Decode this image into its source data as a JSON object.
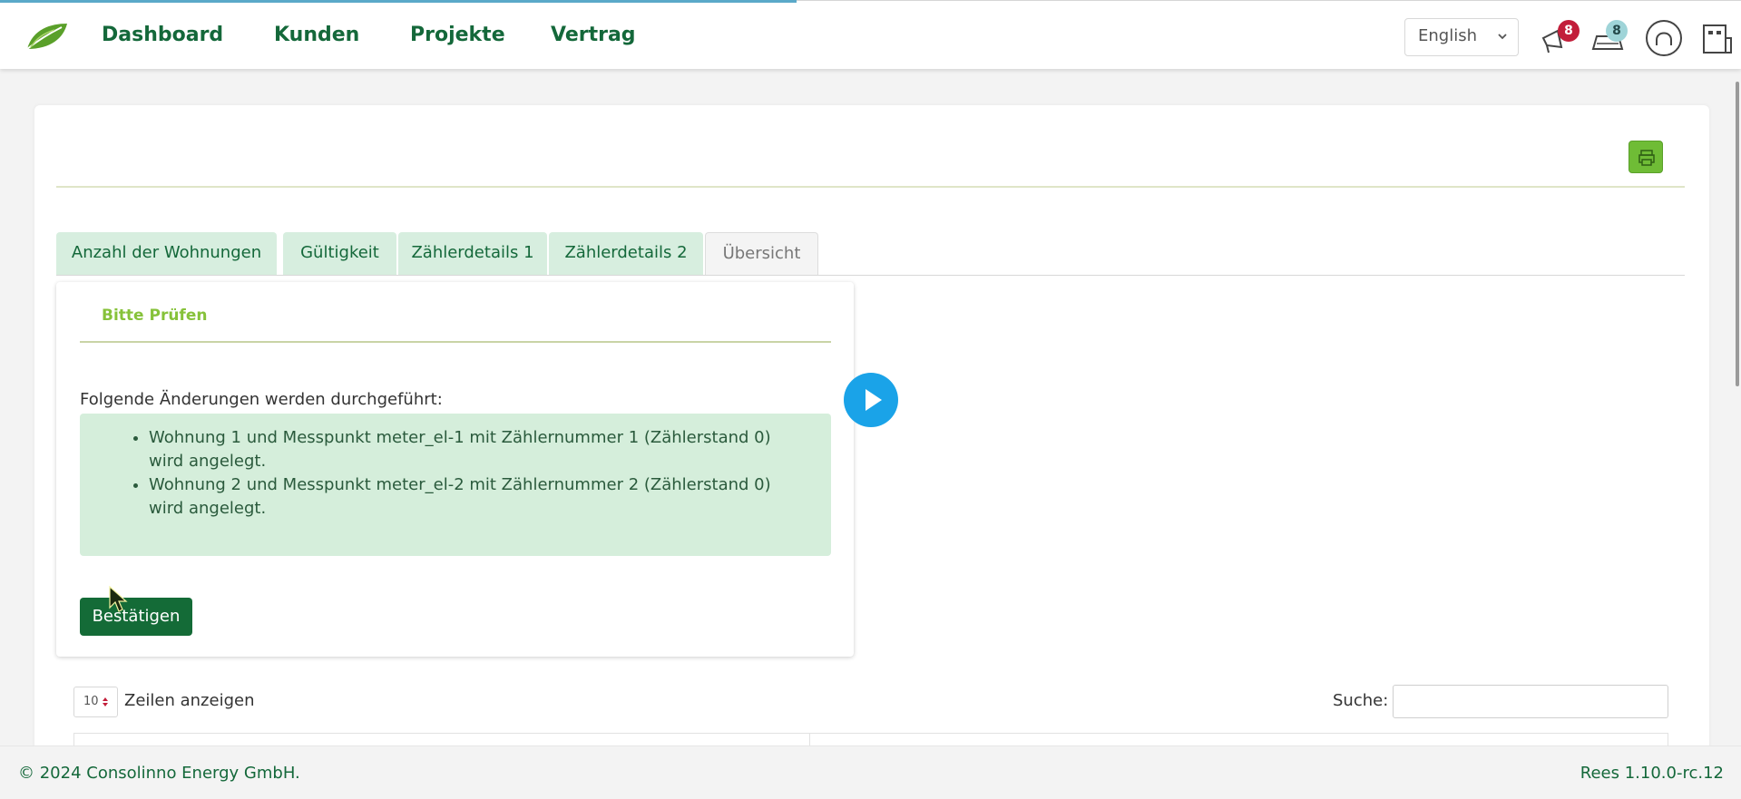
{
  "nav": {
    "items": [
      "Dashboard",
      "Kunden",
      "Projekte",
      "Vertrag"
    ],
    "language": "English",
    "notification_count": "8",
    "message_count": "8"
  },
  "tabs": [
    {
      "label": "Anzahl der Wohnungen"
    },
    {
      "label": "Gültigkeit"
    },
    {
      "label": "Zählerdetails 1"
    },
    {
      "label": "Zählerdetails 2"
    },
    {
      "label": "Übersicht"
    }
  ],
  "panel": {
    "heading": "Bitte Prüfen",
    "intro": "Folgende Änderungen werden durchgeführt:",
    "changes": [
      "Wohnung 1 und Messpunkt meter_el-1 mit Zählernummer 1 (Zählerstand 0) wird angelegt.",
      "Wohnung 2 und Messpunkt meter_el-2 mit Zählernummer 2 (Zählerstand 0) wird angelegt."
    ],
    "confirm_label": "Bestätigen"
  },
  "table": {
    "page_length": "10",
    "length_label": "Zeilen anzeigen",
    "search_label": "Suche:",
    "search_value": ""
  },
  "footer": {
    "copyright": "© 2024 Consolinno Energy GmbH.",
    "version": "Rees 1.10.0-rc.12"
  },
  "colors": {
    "brand_green": "#14683a",
    "accent_green": "#86c23a",
    "tab_bg": "#d7eedf",
    "badge_red": "#c21e3a",
    "badge_teal": "#9fd4d8",
    "play_blue": "#1aa3e8"
  },
  "icons": {
    "logo": "leaf-logo",
    "print": "print-icon",
    "notifications": "megaphone-icon",
    "messages": "chat-icon",
    "account": "user-support-icon",
    "building": "building-icon",
    "play": "play-icon"
  }
}
